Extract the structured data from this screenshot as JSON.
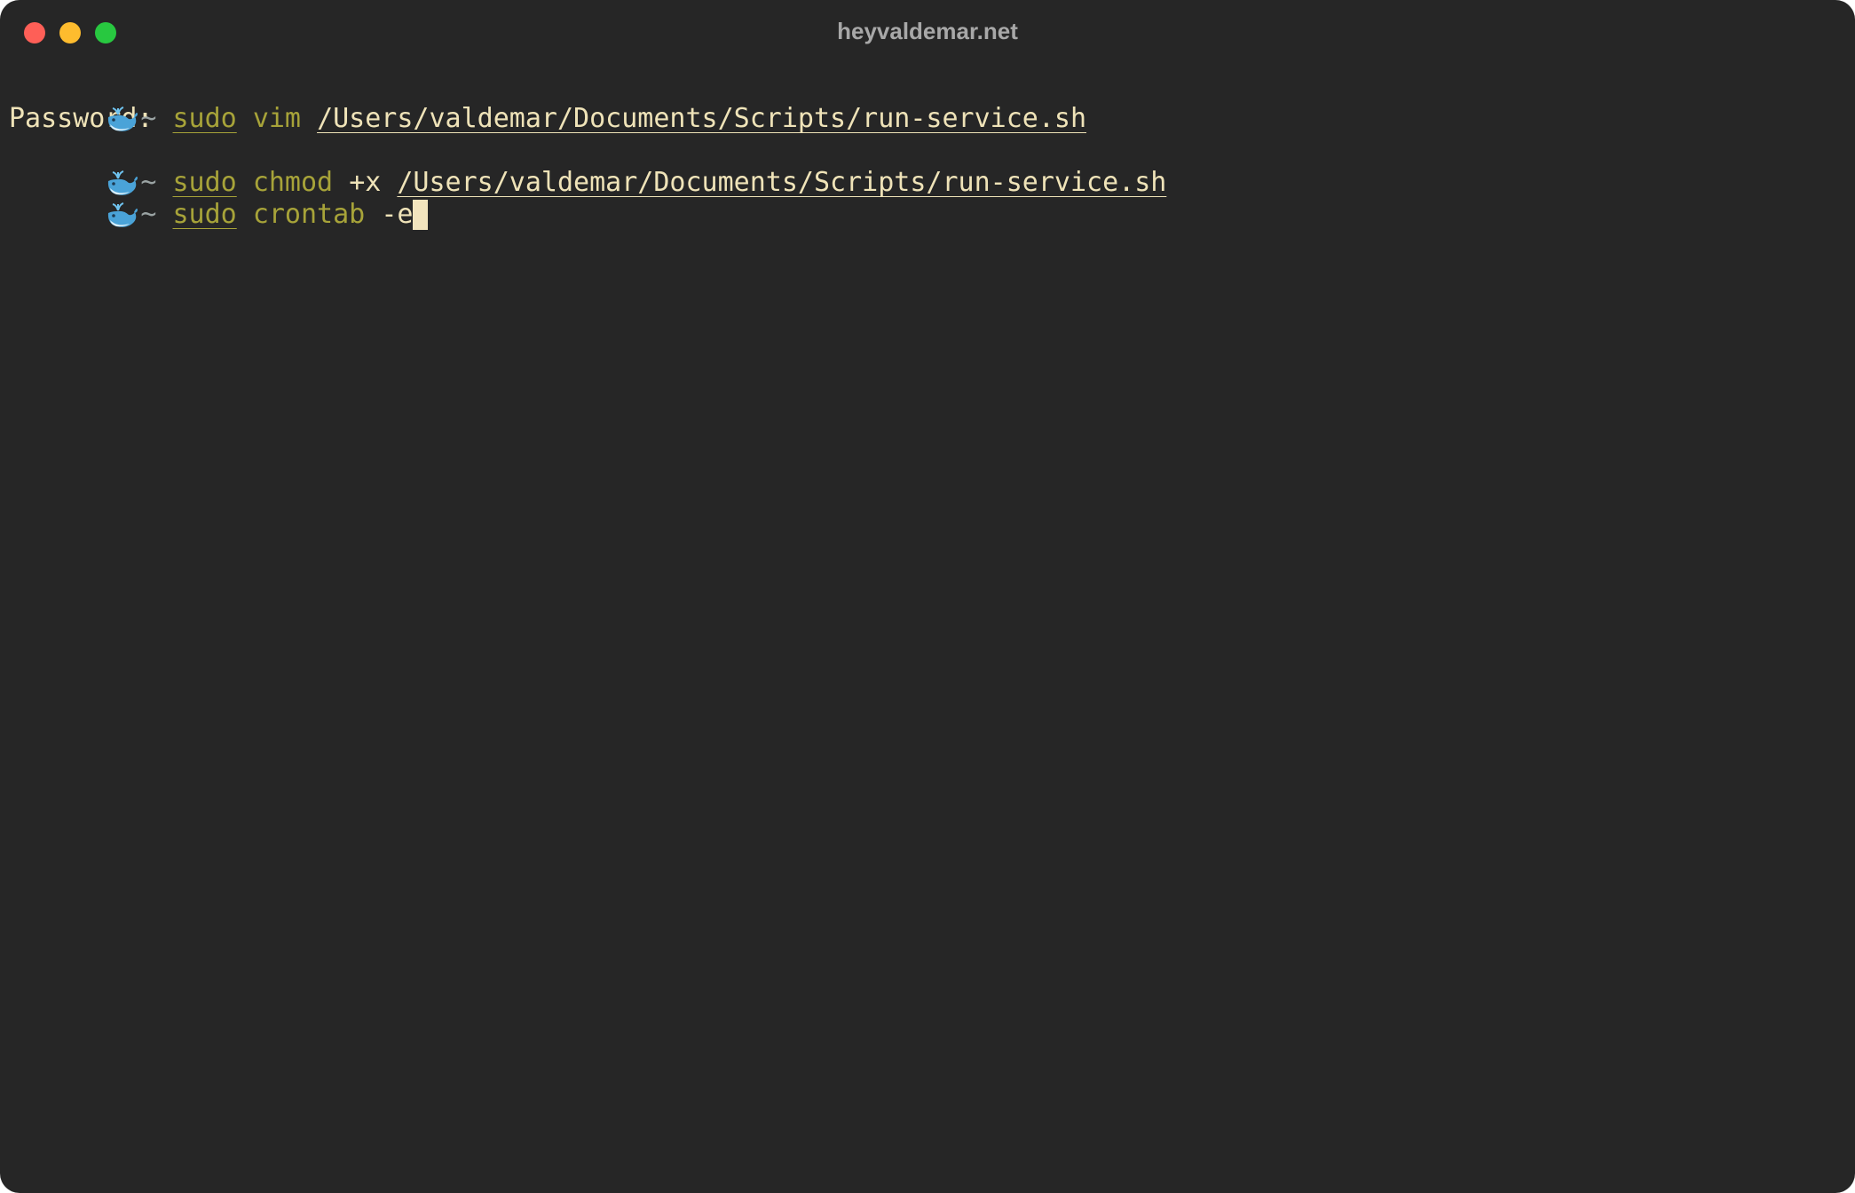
{
  "window": {
    "title": "heyvaldemar.net",
    "traffic_lights": {
      "close_color": "#fe5f57",
      "minimize_color": "#febc2e",
      "zoom_color": "#28c840"
    }
  },
  "prompt": {
    "icon": "whale-icon",
    "dir": "~"
  },
  "lines": [
    {
      "type": "command",
      "sudo": "sudo",
      "command": "vim",
      "args": "",
      "path": "/Users/valdemar/Documents/Scripts/run-service.sh"
    },
    {
      "type": "output",
      "text": "Password:"
    },
    {
      "type": "command",
      "sudo": "sudo",
      "command": "chmod",
      "args": "+x",
      "path": "/Users/valdemar/Documents/Scripts/run-service.sh"
    },
    {
      "type": "input",
      "sudo": "sudo",
      "command": "crontab",
      "args": "-e"
    }
  ],
  "colors": {
    "background": "#262626",
    "command": "#a7a339",
    "text": "#efe3b8",
    "tilde": "#9aa3a3",
    "cursor": "#f2e4bd"
  }
}
